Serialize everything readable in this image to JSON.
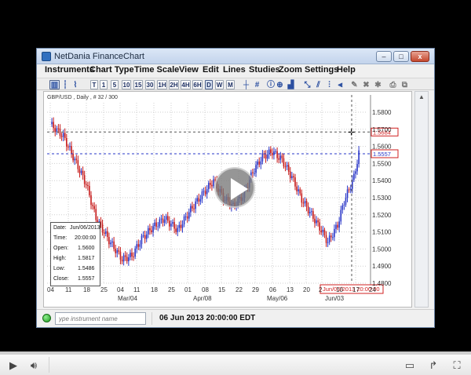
{
  "window": {
    "title": "NetDania FinanceChart",
    "min_glyph": "–",
    "max_glyph": "□",
    "close_glyph": "x"
  },
  "menu": [
    "Instruments",
    "Chart Type",
    "Time Scale",
    "View",
    "Edit",
    "Lines",
    "Studies",
    "Zoom",
    "Settings",
    "Help"
  ],
  "toolbar": {
    "timeframes": [
      "T",
      "1",
      "5",
      "10",
      "15",
      "30",
      "1H",
      "2H",
      "4H",
      "6H",
      "D",
      "W",
      "M"
    ],
    "selected_timeframe": "D"
  },
  "chart": {
    "instrument_label": "GBP/USD , Daily , # 32 / 300",
    "y_ticks": [
      "1.5800",
      "1.5700",
      "1.5600",
      "1.5500",
      "1.5400",
      "1.5300",
      "1.5200",
      "1.5100",
      "1.5000",
      "1.4900",
      "1.4800"
    ],
    "price_tags": {
      "upper": "1.5684",
      "lower": "1.5557"
    },
    "crosshair_date_label": "Jun/06/2013 20:00:00",
    "x_day_labels": [
      "04",
      "11",
      "18",
      "25",
      "04",
      "11",
      "18",
      "25",
      "01",
      "08",
      "15",
      "22",
      "29",
      "06",
      "13",
      "20",
      "2",
      "10",
      "17",
      "24"
    ],
    "x_month_labels": [
      "Mar/04",
      "Apr/08",
      "May/06",
      "Jun/03"
    ],
    "colors": {
      "up": "#2a37c8",
      "down": "#c61b1b",
      "grid": "#cfcfcf",
      "tag": "#d02020"
    }
  },
  "ohlc_box": {
    "date_label": "Date:",
    "date": "Jun/06/2013",
    "time_label": "Time:",
    "time": "20:00:00",
    "open_label": "Open:",
    "open": "1.5600",
    "high_label": "High:",
    "high": "1.5817",
    "low_label": "Low:",
    "low": "1.5486",
    "close_label": "Close:",
    "close": "1.5557"
  },
  "status": {
    "instrument_placeholder": "ype instrument name",
    "datetime": "06 Jun 2013 20:00:00 EDT"
  },
  "player": {
    "progress": 0.0,
    "fullscreen_glyph": "⛶"
  }
}
